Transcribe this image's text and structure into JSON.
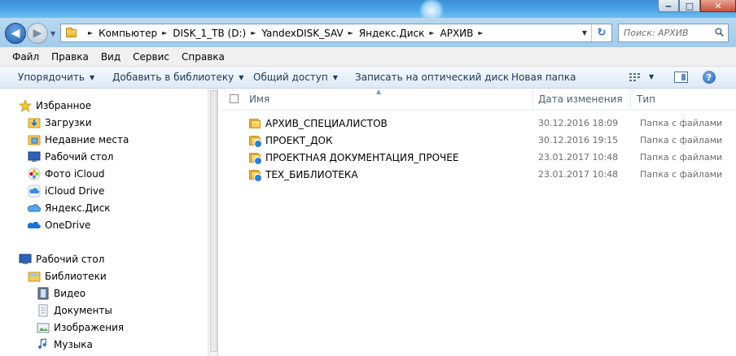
{
  "window": {
    "minimize_icon": "minimize-icon",
    "maximize_icon": "maximize-icon",
    "close_icon": "close-icon"
  },
  "address": {
    "crumbs": [
      "Компьютер",
      "DISK_1_TB (D:)",
      "YandexDISK_SAV",
      "Яндекс.Диск",
      "АРХИВ"
    ],
    "search_placeholder": "Поиск: АРХИВ"
  },
  "menu": [
    "Файл",
    "Правка",
    "Вид",
    "Сервис",
    "Справка"
  ],
  "toolbar": {
    "organize": "Упорядочить",
    "add_to_library": "Добавить в библиотеку",
    "share": "Общий доступ",
    "burn": "Записать на оптический диск",
    "new_folder": "Новая папка"
  },
  "nav": {
    "favorites_title": "Избранное",
    "favorites": [
      "Загрузки",
      "Недавние места",
      "Рабочий стол",
      "Фото iCloud",
      "iCloud Drive",
      "Яндекс.Диск",
      "OneDrive"
    ],
    "desktop_title": "Рабочий стол",
    "libraries_title": "Библиотеки",
    "libraries": [
      "Видео",
      "Документы",
      "Изображения",
      "Музыка"
    ]
  },
  "columns": {
    "name": "Имя",
    "date": "Дата изменения",
    "type": "Тип"
  },
  "files": [
    {
      "name": "АРХИВ_СПЕЦИАЛИСТОВ",
      "date": "30.12.2016 18:09",
      "type": "Папка с файлами",
      "synced": false
    },
    {
      "name": "ПРОЕКТ_ДОК",
      "date": "30.12.2016 19:15",
      "type": "Папка с файлами",
      "synced": true
    },
    {
      "name": "ПРОЕКТНАЯ ДОКУМЕНТАЦИЯ_ПРОЧЕЕ",
      "date": "23.01.2017 10:48",
      "type": "Папка с файлами",
      "synced": true
    },
    {
      "name": "ТЕХ_БИБЛИОТЕКА",
      "date": "23.01.2017 10:48",
      "type": "Папка с файлами",
      "synced": true
    }
  ]
}
